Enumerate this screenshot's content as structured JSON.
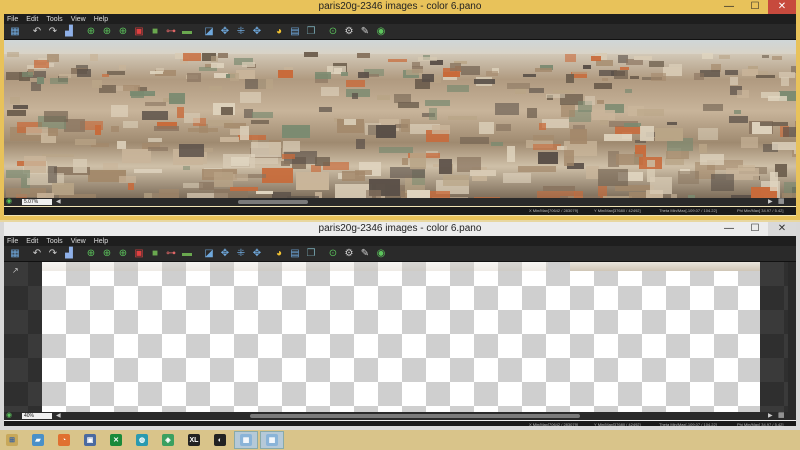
{
  "windows": [
    {
      "title": "paris20g-2346 images - color 6.pano",
      "menu": [
        "File",
        "Edit",
        "Tools",
        "View",
        "Help"
      ],
      "zoom": "5.07%",
      "status": {
        "x": "X Min/Max[70642 / 283079]",
        "y": "Y Min/Max[37680 / 42492]",
        "theta": "Theta Min/Max[-109.07 / 104.22]",
        "phi": "Phi Min/Max[ 34.97 / 5.42]"
      }
    },
    {
      "title": "paris20g-2346 images - color 6.pano",
      "menu": [
        "File",
        "Edit",
        "Tools",
        "View",
        "Help"
      ],
      "zoom": "40%",
      "status": {
        "x": "X Min/Max[70642 / 283079]",
        "y": "Y Min/Max[37680 / 42492]",
        "theta": "Theta Min/Max[-109.07 / 104.22]",
        "phi": "Phi Min/Max[ 34.97 / 5.42]"
      }
    }
  ],
  "window_controls": {
    "minimize": "—",
    "maximize": "☐",
    "close": "✕"
  },
  "toolbar_icons": [
    {
      "name": "layout-icon",
      "glyph": "▦",
      "color": "#6fa8dc"
    },
    {
      "name": "undo-icon",
      "glyph": "↶",
      "color": "#cfcfcf"
    },
    {
      "name": "redo-icon",
      "glyph": "↷",
      "color": "#cfcfcf"
    },
    {
      "name": "histogram-icon",
      "glyph": "▟",
      "color": "#8fb0e8"
    },
    {
      "name": "rotate-left-icon",
      "glyph": "⊕",
      "color": "#5cc45c"
    },
    {
      "name": "rotate-right-icon",
      "glyph": "⊕",
      "color": "#5cc45c"
    },
    {
      "name": "flip-icon",
      "glyph": "⊕",
      "color": "#5cc45c"
    },
    {
      "name": "crop-icon",
      "glyph": "▣",
      "color": "#e04040"
    },
    {
      "name": "frame-icon",
      "glyph": "■",
      "color": "#6aa84f"
    },
    {
      "name": "horizon-icon",
      "glyph": "⊶",
      "color": "#e06666"
    },
    {
      "name": "level-icon",
      "glyph": "▬",
      "color": "#6aa84f"
    },
    {
      "name": "select-icon",
      "glyph": "◪",
      "color": "#6fa8dc"
    },
    {
      "name": "move-icon",
      "glyph": "✥",
      "color": "#6fa8dc"
    },
    {
      "name": "control-points-icon",
      "glyph": "⁜",
      "color": "#6fa8dc"
    },
    {
      "name": "grid-points-icon",
      "glyph": "✥",
      "color": "#6fa8dc"
    },
    {
      "name": "color-wheel-icon",
      "glyph": "◕",
      "color": "#f1c232"
    },
    {
      "name": "image-list-icon",
      "glyph": "▤",
      "color": "#6fa8dc"
    },
    {
      "name": "layers-icon",
      "glyph": "❐",
      "color": "#76a5af"
    },
    {
      "name": "zoom-icon",
      "glyph": "⊙",
      "color": "#5cc45c"
    },
    {
      "name": "settings-icon",
      "glyph": "⚙",
      "color": "#cfcfcf"
    },
    {
      "name": "tools-icon",
      "glyph": "✎",
      "color": "#cfcfcf"
    },
    {
      "name": "web-icon",
      "glyph": "◉",
      "color": "#5cc45c"
    }
  ],
  "taskbar": [
    {
      "name": "windows-start-icon",
      "glyph": "⊞",
      "bg": "#c8a85a",
      "fg": "#2a5caa"
    },
    {
      "name": "explorer-icon",
      "glyph": "▰",
      "bg": "#4a90c8",
      "fg": "#fff"
    },
    {
      "name": "firefox-icon",
      "glyph": "◔",
      "bg": "#e07030",
      "fg": "#fff"
    },
    {
      "name": "app-icon",
      "glyph": "▣",
      "bg": "#4a6aa0",
      "fg": "#fff"
    },
    {
      "name": "xbox-icon",
      "glyph": "✕",
      "bg": "#1a8a3a",
      "fg": "#fff"
    },
    {
      "name": "globe-icon",
      "glyph": "◍",
      "bg": "#2a9ab0",
      "fg": "#fff"
    },
    {
      "name": "chart-app-icon",
      "glyph": "◈",
      "bg": "#3aa060",
      "fg": "#fff"
    },
    {
      "name": "xl-icon",
      "glyph": "XL",
      "bg": "#222",
      "fg": "#fff"
    },
    {
      "name": "dark-app-icon",
      "glyph": "◐",
      "bg": "#222",
      "fg": "#fff"
    },
    {
      "name": "pano-app-icon-1",
      "glyph": "▦",
      "bg": "#8ab4d8",
      "fg": "#fff"
    },
    {
      "name": "pano-app-icon-2",
      "glyph": "▦",
      "bg": "#8ab4d8",
      "fg": "#fff"
    }
  ]
}
